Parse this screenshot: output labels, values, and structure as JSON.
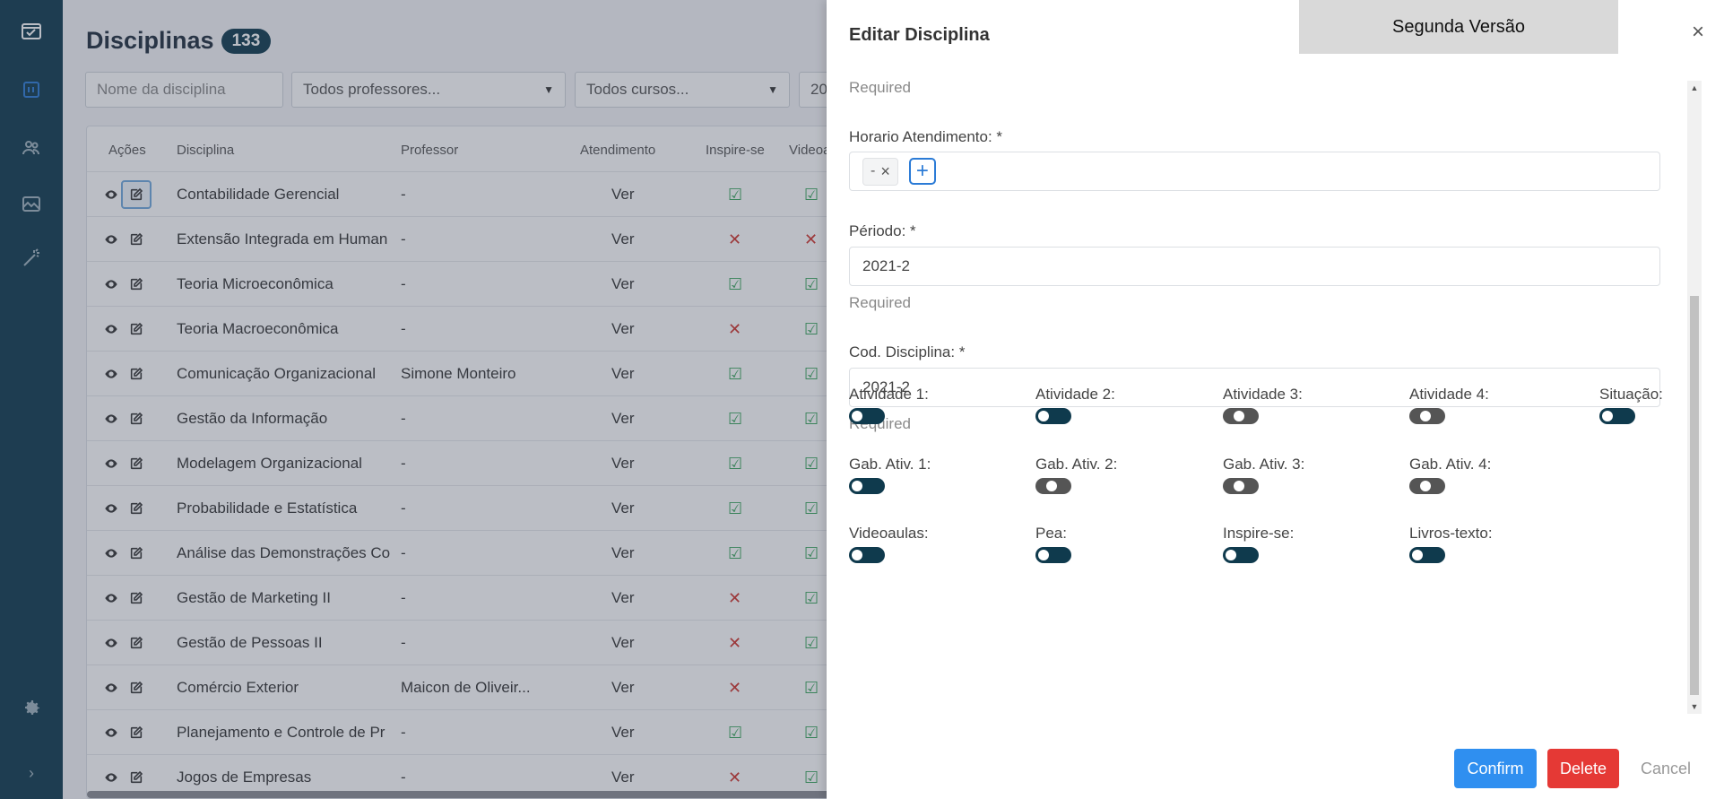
{
  "page": {
    "title": "Disciplinas",
    "count": "133"
  },
  "filters": {
    "name_placeholder": "Nome da disciplina",
    "professor": "Todos professores...",
    "curso": "Todos cursos...",
    "periodo": "20"
  },
  "table": {
    "headers": [
      "Ações",
      "Disciplina",
      "Professor",
      "Atendimento",
      "Inspire-se",
      "Videoa"
    ],
    "rows": [
      {
        "disciplina": "Contabilidade Gerencial",
        "professor": "-",
        "atendimento": "Ver",
        "inspire": "check",
        "video": "check"
      },
      {
        "disciplina": "Extensão Integrada em Human",
        "professor": "-",
        "atendimento": "Ver",
        "inspire": "cross",
        "video": "cross"
      },
      {
        "disciplina": "Teoria Microeconômica",
        "professor": "-",
        "atendimento": "Ver",
        "inspire": "check",
        "video": "check"
      },
      {
        "disciplina": "Teoria Macroeconômica",
        "professor": "-",
        "atendimento": "Ver",
        "inspire": "cross",
        "video": "check"
      },
      {
        "disciplina": "Comunicação Organizacional",
        "professor": "Simone Monteiro",
        "atendimento": "Ver",
        "inspire": "check",
        "video": "check"
      },
      {
        "disciplina": "Gestão da Informação",
        "professor": "-",
        "atendimento": "Ver",
        "inspire": "check",
        "video": "check"
      },
      {
        "disciplina": "Modelagem Organizacional",
        "professor": "-",
        "atendimento": "Ver",
        "inspire": "check",
        "video": "check"
      },
      {
        "disciplina": "Probabilidade e Estatística",
        "professor": "-",
        "atendimento": "Ver",
        "inspire": "check",
        "video": "check"
      },
      {
        "disciplina": "Análise das Demonstrações Co",
        "professor": "-",
        "atendimento": "Ver",
        "inspire": "check",
        "video": "check"
      },
      {
        "disciplina": "Gestão de Marketing II",
        "professor": "-",
        "atendimento": "Ver",
        "inspire": "cross",
        "video": "check"
      },
      {
        "disciplina": "Gestão de Pessoas II",
        "professor": "-",
        "atendimento": "Ver",
        "inspire": "cross",
        "video": "check"
      },
      {
        "disciplina": "Comércio Exterior",
        "professor": "Maicon de Oliveir...",
        "atendimento": "Ver",
        "inspire": "cross",
        "video": "check"
      },
      {
        "disciplina": "Planejamento e Controle de Pr",
        "professor": "-",
        "atendimento": "Ver",
        "inspire": "check",
        "video": "check"
      },
      {
        "disciplina": "Jogos de Empresas",
        "professor": "-",
        "atendimento": "Ver",
        "inspire": "cross",
        "video": "check"
      }
    ]
  },
  "drawer": {
    "title": "Editar Disciplina",
    "version_label": "Segunda Versão",
    "required_text": "Required",
    "horario_label": "Horario Atendimento: *",
    "horario_chip": "-",
    "periodo_label": "Périodo: *",
    "periodo_value": "2021-2",
    "cod_label": "Cod. Disciplina: *",
    "cod_value": "2021-2",
    "toggles": [
      {
        "label": "Atividade 1:",
        "on": true
      },
      {
        "label": "Atividade 2:",
        "on": true
      },
      {
        "label": "Atividade 3:",
        "on": false
      },
      {
        "label": "Atividade 4:",
        "on": false
      },
      {
        "label": "Situação:",
        "on": true
      },
      {
        "label": "Gab. Ativ. 1:",
        "on": true
      },
      {
        "label": "Gab. Ativ. 2:",
        "on": false
      },
      {
        "label": "Gab. Ativ. 3:",
        "on": false
      },
      {
        "label": "Gab. Ativ. 4:",
        "on": false
      },
      {
        "label": "Videoaulas:",
        "on": true
      },
      {
        "label": "Pea:",
        "on": true
      },
      {
        "label": "Inspire-se:",
        "on": true
      },
      {
        "label": "Livros-texto:",
        "on": true
      }
    ],
    "confirm_label": "Confirm",
    "delete_label": "Delete",
    "cancel_label": "Cancel"
  },
  "colors": {
    "sidebar": "#0f3a4d",
    "primary": "#2f8ff0",
    "danger": "#e53935",
    "check": "#3aa55c",
    "cross": "#d0342c"
  }
}
